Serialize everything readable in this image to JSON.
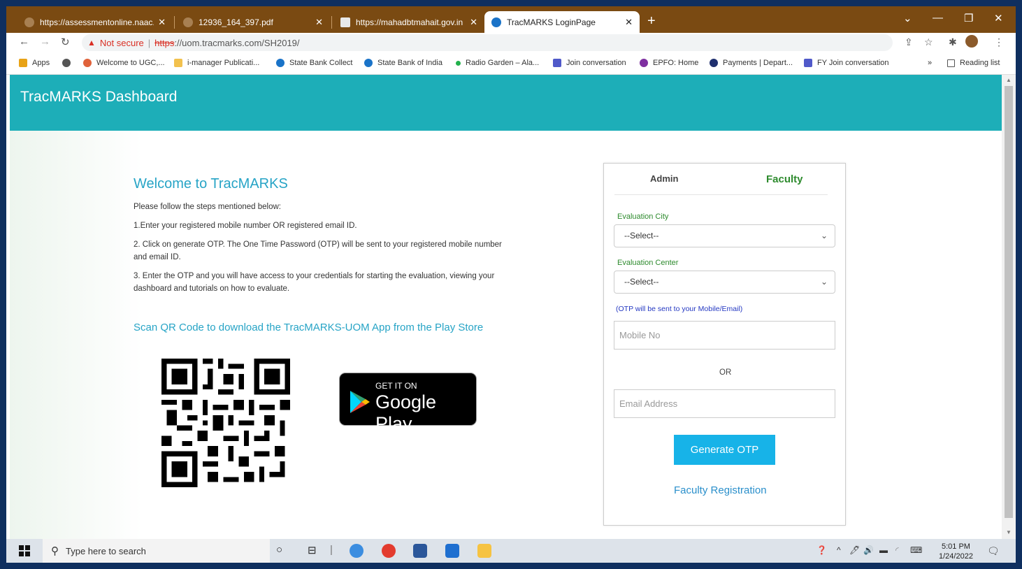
{
  "browser": {
    "tabs": [
      {
        "title": "https://assessmentonline.naac.gc",
        "active": false
      },
      {
        "title": "12936_164_397.pdf",
        "active": false
      },
      {
        "title": "https://mahadbtmahait.gov.in",
        "active": false
      },
      {
        "title": "TracMARKS LoginPage",
        "active": true
      }
    ],
    "new_tab": "+",
    "address": {
      "warning_icon": "▲",
      "not_secure": "Not secure",
      "separator": "|",
      "scheme": "https",
      "rest": "://uom.tracmarks.com/SH2019/"
    },
    "bookmarks": [
      {
        "label": "Apps",
        "color": "#e8a317"
      },
      {
        "label": "",
        "color": "#555555"
      },
      {
        "label": "Welcome to UGC,...",
        "color": "#e0623a"
      },
      {
        "label": "i-manager Publicati...",
        "color": "#f2c14e"
      },
      {
        "label": "State Bank Collect",
        "color": "#1a73c8"
      },
      {
        "label": "State Bank of India",
        "color": "#1a73c8"
      },
      {
        "label": "Radio Garden – Ala...",
        "color": "#22b14c"
      },
      {
        "label": "Join conversation",
        "color": "#5059c9"
      },
      {
        "label": "EPFO: Home",
        "color": "#7e2fa0"
      },
      {
        "label": "Payments | Depart...",
        "color": "#1f2f6e"
      },
      {
        "label": "FY Join conversation",
        "color": "#5059c9"
      }
    ],
    "more_bookmarks": "»",
    "reading_list": "Reading list"
  },
  "page": {
    "header_title": "TracMARKS Dashboard",
    "welcome_title": "Welcome to TracMARKS",
    "intro": "Please follow the steps mentioned below:",
    "steps": [
      "1.Enter your registered mobile number OR registered email ID.",
      "2. Click on generate OTP. The One Time Password (OTP) will be sent to your registered mobile number and email ID.",
      "3. Enter the OTP and you will have access to your credentials for starting the evaluation, viewing your dashboard and tutorials on how to evaluate."
    ],
    "qr_heading": "Scan QR Code to download the TracMARKS-UOM App from the Play Store",
    "gplay_small": "GET IT ON",
    "gplay_big": "Google Play"
  },
  "login": {
    "tab_admin": "Admin",
    "tab_faculty": "Faculty",
    "city_label": "Evaluation City",
    "city_value": "--Select--",
    "center_label": "Evaluation Center",
    "center_value": "--Select--",
    "otp_note": "(OTP will be sent to your Mobile/Email)",
    "mobile_placeholder": "Mobile No",
    "or_text": "OR",
    "email_placeholder": "Email Address",
    "generate_label": "Generate OTP",
    "register_label": "Faculty Registration"
  },
  "taskbar": {
    "search_placeholder": "Type here to search",
    "time": "5:01 PM",
    "date": "1/24/2022"
  },
  "colors": {
    "header_teal": "#1daeb8",
    "accent_green": "#2e8b2e",
    "button_blue": "#17b3e8",
    "tab_strip": "#7a4a12"
  }
}
